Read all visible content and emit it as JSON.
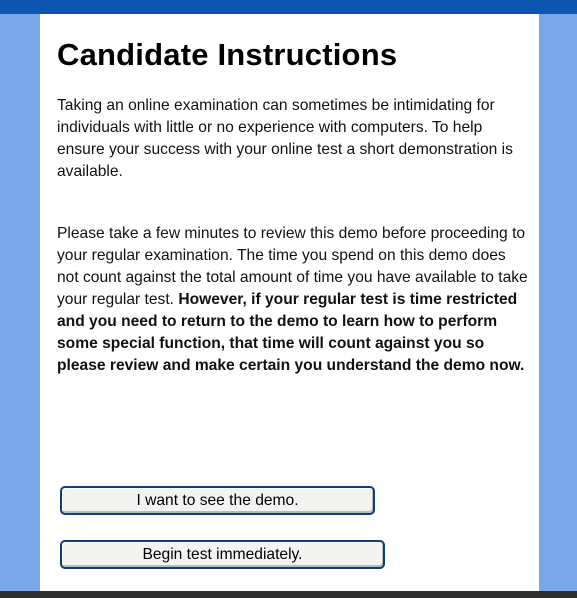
{
  "page": {
    "title": "Candidate Instructions",
    "paragraph1": "Taking an online examination can sometimes be intimidating for individuals with little or no experience with computers.  To help ensure your success with your online test a short demonstration is available.",
    "paragraph2_regular": "Please take a few minutes to review this demo before proceeding to your regular examination.  The time you spend on this demo does not count against the total amount of time you have available to take your regular test. ",
    "paragraph2_bold": "However, if your regular test is time restricted and you need to return to the demo to learn how to perform some special function, that time will count against you so please review and make certain you understand the demo now."
  },
  "buttons": {
    "demo_label": "I want to see the demo.",
    "begin_label": "Begin test immediately."
  },
  "colors": {
    "top_bar": "#0d55b3",
    "side_background": "#7aa6ea",
    "panel": "#ffffff",
    "bottom_bar": "#2f2f2f",
    "button_border": "#123e78"
  }
}
